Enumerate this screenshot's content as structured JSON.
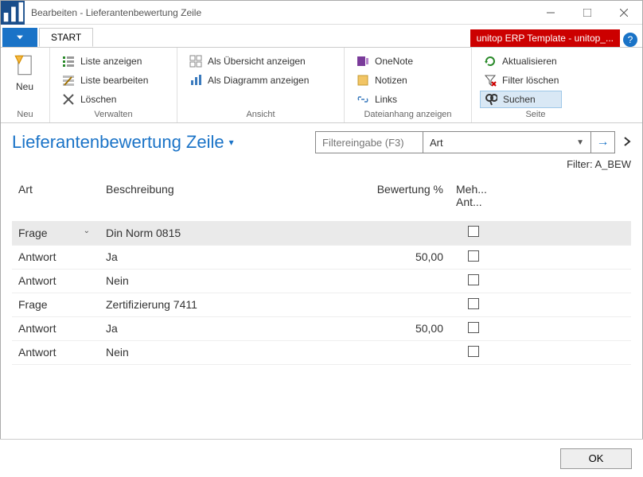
{
  "window": {
    "title": "Bearbeiten - Lieferantenbewertung Zeile"
  },
  "tabs": {
    "active": "START"
  },
  "badge": "unitop ERP Template - unitop_...",
  "ribbon": {
    "g_neu": {
      "label": "Neu",
      "neu": "Neu"
    },
    "g_verwalten": {
      "label": "Verwalten",
      "liste_anzeigen": "Liste anzeigen",
      "liste_bearbeiten": "Liste bearbeiten",
      "loeschen": "Löschen"
    },
    "g_ansicht": {
      "label": "Ansicht",
      "als_uebersicht": "Als Übersicht anzeigen",
      "als_diagramm": "Als Diagramm anzeigen"
    },
    "g_datei": {
      "label": "Dateianhang anzeigen",
      "onenote": "OneNote",
      "notizen": "Notizen",
      "links": "Links"
    },
    "g_seite": {
      "label": "Seite",
      "aktualisieren": "Aktualisieren",
      "filter_loeschen": "Filter löschen",
      "suchen": "Suchen"
    }
  },
  "page": {
    "title": "Lieferantenbewertung Zeile",
    "filter_placeholder": "Filtereingabe (F3)",
    "filter_field": "Art",
    "filter_status": "Filter: A_BEW"
  },
  "columns": {
    "art": "Art",
    "beschreibung": "Beschreibung",
    "bewertung": "Bewertung %",
    "meh": "Meh...\nAnt..."
  },
  "rows": [
    {
      "art": "Frage",
      "beschr": "Din Norm 0815",
      "bew": "",
      "chk": false,
      "sel": true,
      "drop": true
    },
    {
      "art": "Antwort",
      "beschr": "Ja",
      "bew": "50,00",
      "chk": false
    },
    {
      "art": "Antwort",
      "beschr": "Nein",
      "bew": "",
      "chk": false
    },
    {
      "art": "Frage",
      "beschr": "Zertifizierung 7411",
      "bew": "",
      "chk": false
    },
    {
      "art": "Antwort",
      "beschr": "Ja",
      "bew": "50,00",
      "chk": false
    },
    {
      "art": "Antwort",
      "beschr": "Nein",
      "bew": "",
      "chk": false
    }
  ],
  "footer": {
    "ok": "OK"
  }
}
